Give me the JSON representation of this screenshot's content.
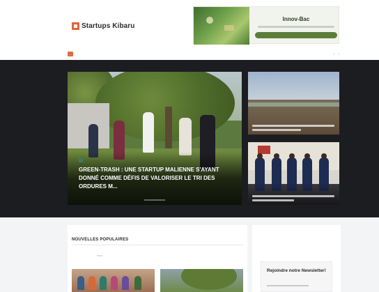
{
  "brand": {
    "name": "Startups Kibaru",
    "accent_color": "#e0643c"
  },
  "ad": {
    "title": "Innov-Bac"
  },
  "ticker": {
    "badge": "",
    "text": "",
    "arrows": "‹ ›"
  },
  "hero": {
    "main": {
      "category": "",
      "title": "GREEN-TRASH : UNE STARTUP MALIENNE S'AYANT DONNÉ COMME DÉFIS DE VALORISER LE TRI DES ORDURES M..."
    }
  },
  "popular": {
    "title": "NOUVELLES POPULAIRES",
    "tabs": [
      "TOUT",
      "",
      "",
      "",
      ""
    ]
  },
  "newsletter": {
    "title": "Rejoindre notre Newsletter!"
  },
  "colors": {
    "hero_background": "#1c1d21",
    "lower_background": "#f3f4f6",
    "category_badge": "#3a7d5a",
    "ticker_badge": "#e36b43"
  }
}
